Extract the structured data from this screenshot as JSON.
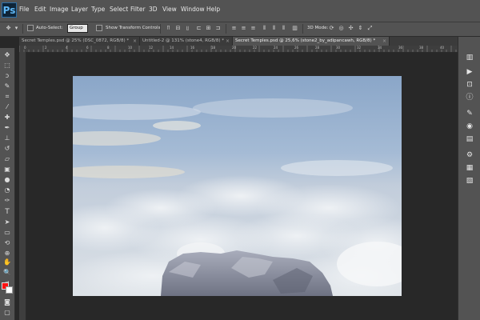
{
  "app": {
    "logo": "Ps"
  },
  "menu": [
    "File",
    "Edit",
    "Image",
    "Layer",
    "Type",
    "Select",
    "Filter",
    "3D",
    "View",
    "Window",
    "Help"
  ],
  "options_bar": {
    "auto_select_label": "Auto-Select:",
    "auto_select_value": "Group",
    "transform_label": "Show Transform Controls",
    "mode_3d_label": "3D Mode:"
  },
  "tabs": [
    {
      "label": "Secret Temples.psd @ 25% (DSC_0872, RGB/8) *",
      "close": "×"
    },
    {
      "label": "Untitled-2 @ 131% (stone4, RGB/8) *",
      "close": "×"
    },
    {
      "label": "Secret Temples.psd @ 25,6% (stone2_by_adipancawh, RGB/8) *",
      "close": "×",
      "active": true
    }
  ],
  "ruler_labels": [
    "0",
    "2",
    "4",
    "6",
    "8",
    "10",
    "12",
    "14",
    "16",
    "18",
    "20",
    "22",
    "24",
    "26",
    "28",
    "30",
    "32",
    "34",
    "36",
    "38",
    "40"
  ],
  "colors": {
    "foreground": "#ff1111",
    "background": "#ffffff"
  }
}
